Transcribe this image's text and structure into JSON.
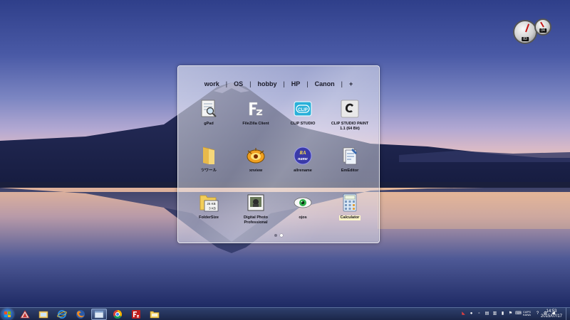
{
  "launcher": {
    "tabs": [
      {
        "label": "work"
      },
      {
        "label": "OS"
      },
      {
        "label": "hobby"
      },
      {
        "label": "HP"
      },
      {
        "label": "Canon"
      },
      {
        "label": "+"
      }
    ],
    "separator": "|",
    "apps": [
      {
        "label": "gPad",
        "icon": "gpad-icon"
      },
      {
        "label": "FileZilla Client",
        "icon": "filezilla-icon"
      },
      {
        "label": "CLIP STUDIO",
        "icon": "clip-studio-icon"
      },
      {
        "label": "CLIP STUDIO PAINT\n1.1 (64 Bit)",
        "icon": "clip-studio-paint-icon"
      },
      {
        "label": "ツワール",
        "icon": "folder-icon"
      },
      {
        "label": "xnview",
        "icon": "xnview-icon"
      },
      {
        "label": "allrename",
        "icon": "allrename-icon"
      },
      {
        "label": "EmEditor",
        "icon": "emeditor-icon"
      },
      {
        "label": "FolderSize",
        "icon": "foldersize-icon"
      },
      {
        "label": "Digital Photo\nProfessional",
        "icon": "digital-photo-professional-icon"
      },
      {
        "label": "ojos",
        "icon": "ojos-icon"
      },
      {
        "label": "Calculator",
        "icon": "calculator-icon"
      }
    ],
    "icon_text": {
      "clip": "CLIP",
      "allrename_top": "RA",
      "allrename_bottom": "name",
      "size_top": "25 KB",
      "size_bottom": "3 KB"
    },
    "pages": 2,
    "active_page": 2,
    "selected_app": "Calculator"
  },
  "gadget": {
    "readout_big": "83",
    "readout_small": "04"
  },
  "taskbar": {
    "pinned": [
      "explorer-app",
      "explorer",
      "internet-explorer",
      "firefox",
      "window-app",
      "chrome",
      "filezilla",
      "folder"
    ],
    "active": "window-app",
    "tray_language": "CAPS\nKANA",
    "time": "14:53",
    "date": "2015/07/17"
  },
  "colors": {
    "accent": "#1f4f9a",
    "highlight": "#fff7c8"
  }
}
